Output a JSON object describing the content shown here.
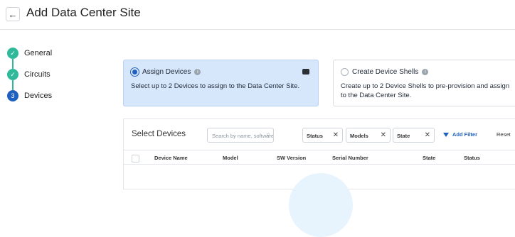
{
  "header": {
    "title": "Add Data Center Site",
    "back_icon": "←"
  },
  "steps": [
    {
      "label": "General",
      "status": "done",
      "marker": "✓"
    },
    {
      "label": "Circuits",
      "status": "done",
      "marker": "✓"
    },
    {
      "label": "Devices",
      "status": "current",
      "marker": "3"
    }
  ],
  "options": {
    "assign": {
      "title": "Assign Devices",
      "description": "Select up to 2 Devices to assign to the Data Center Site.",
      "selected": true
    },
    "shell": {
      "title": "Create Device Shells",
      "description": "Create up to 2 Device Shells to pre-provision and assign to the Data Center Site.",
      "selected": false
    }
  },
  "table": {
    "title": "Select Devices",
    "search_placeholder": "Search by name, software",
    "filters": [
      {
        "label": "Status"
      },
      {
        "label": "Models"
      },
      {
        "label": "State"
      }
    ],
    "add_filter_label": "Add Filter",
    "reset_label": "Reset",
    "columns": [
      "Device Name",
      "Model",
      "SW Version",
      "Serial Number",
      "State",
      "Status"
    ]
  },
  "icons": {
    "info": "i",
    "close": "✕",
    "search": "⌕"
  },
  "colors": {
    "accent": "#1f5fbf",
    "success": "#2fb99a",
    "selected_card_bg": "#d6e6fb"
  }
}
